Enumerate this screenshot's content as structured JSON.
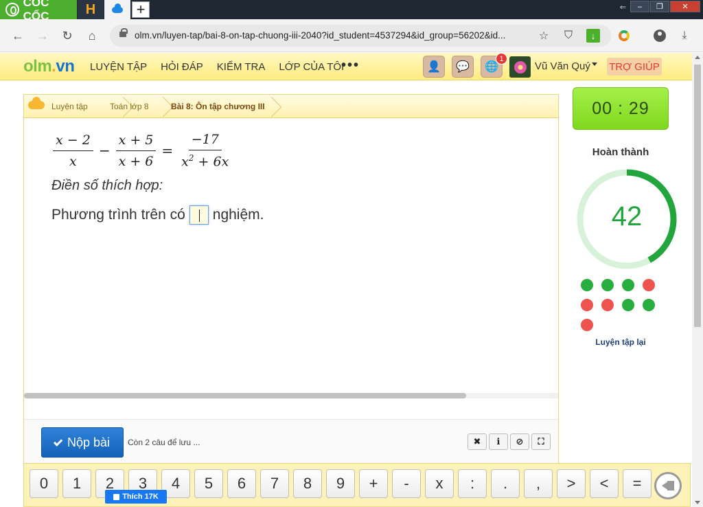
{
  "browser": {
    "brand": "CỐC CỐC",
    "tab_h_label": "H",
    "newtab": "+",
    "url": "olm.vn/luyen-tap/bai-8-on-tap-chuong-iii-2040?id_student=4537294&id_group=56202&id...",
    "window_controls": [
      "–",
      "❐",
      "✕"
    ]
  },
  "site": {
    "logo": {
      "part1": "olm",
      "part2": ".",
      "part3": "vn"
    },
    "nav": [
      "LUYỆN TẬP",
      "HỎI ĐÁP",
      "KIỂM TRA",
      "LỚP CỦA TÔI"
    ],
    "more": "•••",
    "notif_count": "1",
    "user_name": "Vũ Văn Quý",
    "help": "TRỢ GIÚP"
  },
  "breadcrumb": [
    "Luyện tập",
    "Toán lớp 8",
    "Bài 8: Ôn tập chương III"
  ],
  "question": {
    "eq": {
      "f1_num": "x − 2",
      "f1_den": "x",
      "op1": "−",
      "f2_num": "x + 5",
      "f2_den": "x + 6",
      "op2": "=",
      "f3_num": "−17",
      "f3_den_base": "x",
      "f3_den_exp": "2",
      "f3_den_rest": " + 6x"
    },
    "instruction": "Điền số thích hợp:",
    "text_before": "Phương trình trên có",
    "text_after": "nghiệm.",
    "answer_value": ""
  },
  "footer": {
    "submit": "Nộp bài",
    "remaining": "Còn 2 câu để lưu ...",
    "tools": [
      "✖",
      "ℹ",
      "⊘",
      "⛶"
    ]
  },
  "sidebar": {
    "timer": "00 : 29",
    "done_label": "Hoàn thành",
    "progress": 42,
    "results": [
      "correct",
      "correct",
      "correct",
      "wrong",
      "wrong",
      "wrong",
      "correct",
      "correct",
      "wrong"
    ],
    "retry": "Luyện tập lại"
  },
  "keypad": [
    "0",
    "1",
    "2",
    "3",
    "4",
    "5",
    "6",
    "7",
    "8",
    "9",
    "+",
    "-",
    "x",
    ":",
    ".",
    ",",
    ">",
    "<",
    "="
  ],
  "facebook": {
    "like": "Thích 17K"
  },
  "colors": {
    "correct": "#27ae3e",
    "wrong": "#ef5350",
    "progress": "#22a53c",
    "progress_track": "#d7f2d9"
  }
}
